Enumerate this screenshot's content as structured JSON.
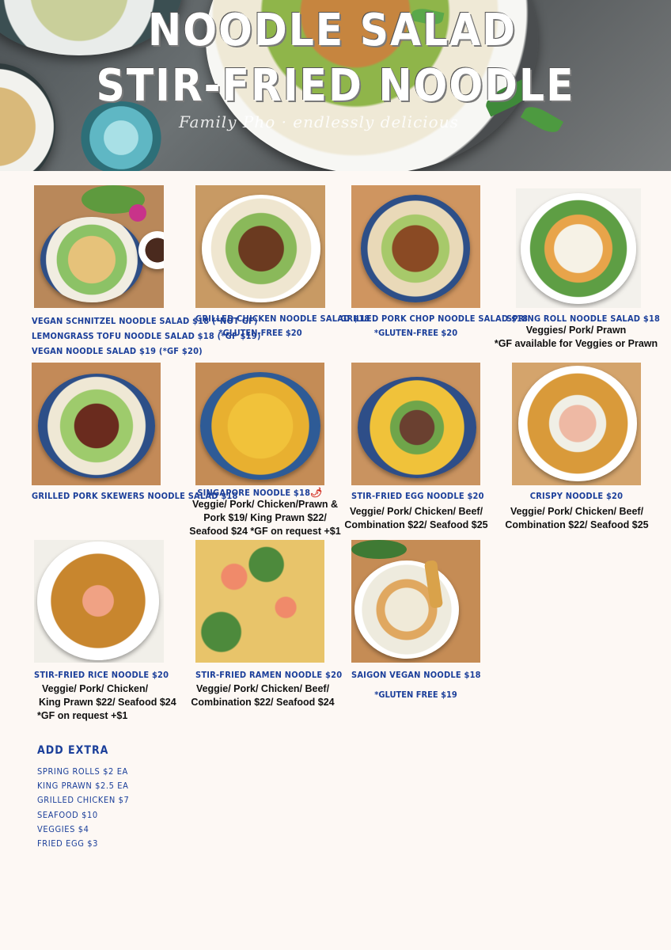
{
  "header": {
    "title_line1": "NOODLE SALAD",
    "title_line2": "STIR-FRIED NOODLE",
    "tagline": "Family Pho · endlessly delicious"
  },
  "colors": {
    "accent_blue": "#1b3f9a",
    "body_text": "#111111",
    "background": "#fdf8f4"
  },
  "items": [
    {
      "lines": [
        "VEGAN SCHNITZEL NOODLE SALAD $18 (*NOT GF)",
        "LEMONGRASS TOFU NOODLE SALAD $18 (*GF $19)",
        "VEGAN NOODLE SALAD $19 (*GF $20)"
      ]
    },
    {
      "name": "GRILLED CHICKEN NOODLE SALAD $18",
      "gf": "*GLUTEN-FREE $20"
    },
    {
      "name": "GRILLED PORK CHOP NOODLE SALAD $18",
      "gf": "*GLUTEN-FREE $20"
    },
    {
      "name": "SPRING ROLL NOODLE SALAD $18",
      "desc": [
        "Veggies/ Pork/ Prawn",
        "*GF available for Veggies or Prawn"
      ]
    },
    {
      "name": "GRILLED PORK SKEWERS NOODLE SALAD $18"
    },
    {
      "name": "SINGAPORE NOODLE $18",
      "name_icon": "chili-icon",
      "desc": [
        "Veggie/ Pork/ Chicken/Prawn &",
        "Pork $19/ King Prawn $22/",
        "Seafood $24 *GF on request +$1"
      ]
    },
    {
      "name": "STIR-FRIED EGG NOODLE $20",
      "desc": [
        "Veggie/ Pork/ Chicken/ Beef/",
        "Combination $22/ Seafood $25"
      ]
    },
    {
      "name": "CRISPY NOODLE $20",
      "desc": [
        "Veggie/ Pork/ Chicken/ Beef/",
        "Combination $22/ Seafood $25"
      ]
    },
    {
      "name": "STIR-FRIED RICE NOODLE $20",
      "desc": [
        "Veggie/ Pork/ Chicken/",
        "King Prawn $22/ Seafood $24",
        "*GF on request +$1"
      ]
    },
    {
      "name": "STIR-FRIED RAMEN NOODLE $20",
      "desc": [
        "Veggie/ Pork/ Chicken/ Beef/",
        "Combination $22/ Seafood $24"
      ]
    },
    {
      "name": "SAIGON VEGAN NOODLE $18",
      "gf": "*GLUTEN FREE $19"
    }
  ],
  "extras": {
    "title": "ADD EXTRA",
    "items": [
      "SPRING ROLLS $2 EA",
      "KING PRAWN $2.5 EA",
      "GRILLED CHICKEN $7",
      "SEAFOOD $10",
      "VEGGIES $4",
      "FRIED EGG $3"
    ]
  }
}
